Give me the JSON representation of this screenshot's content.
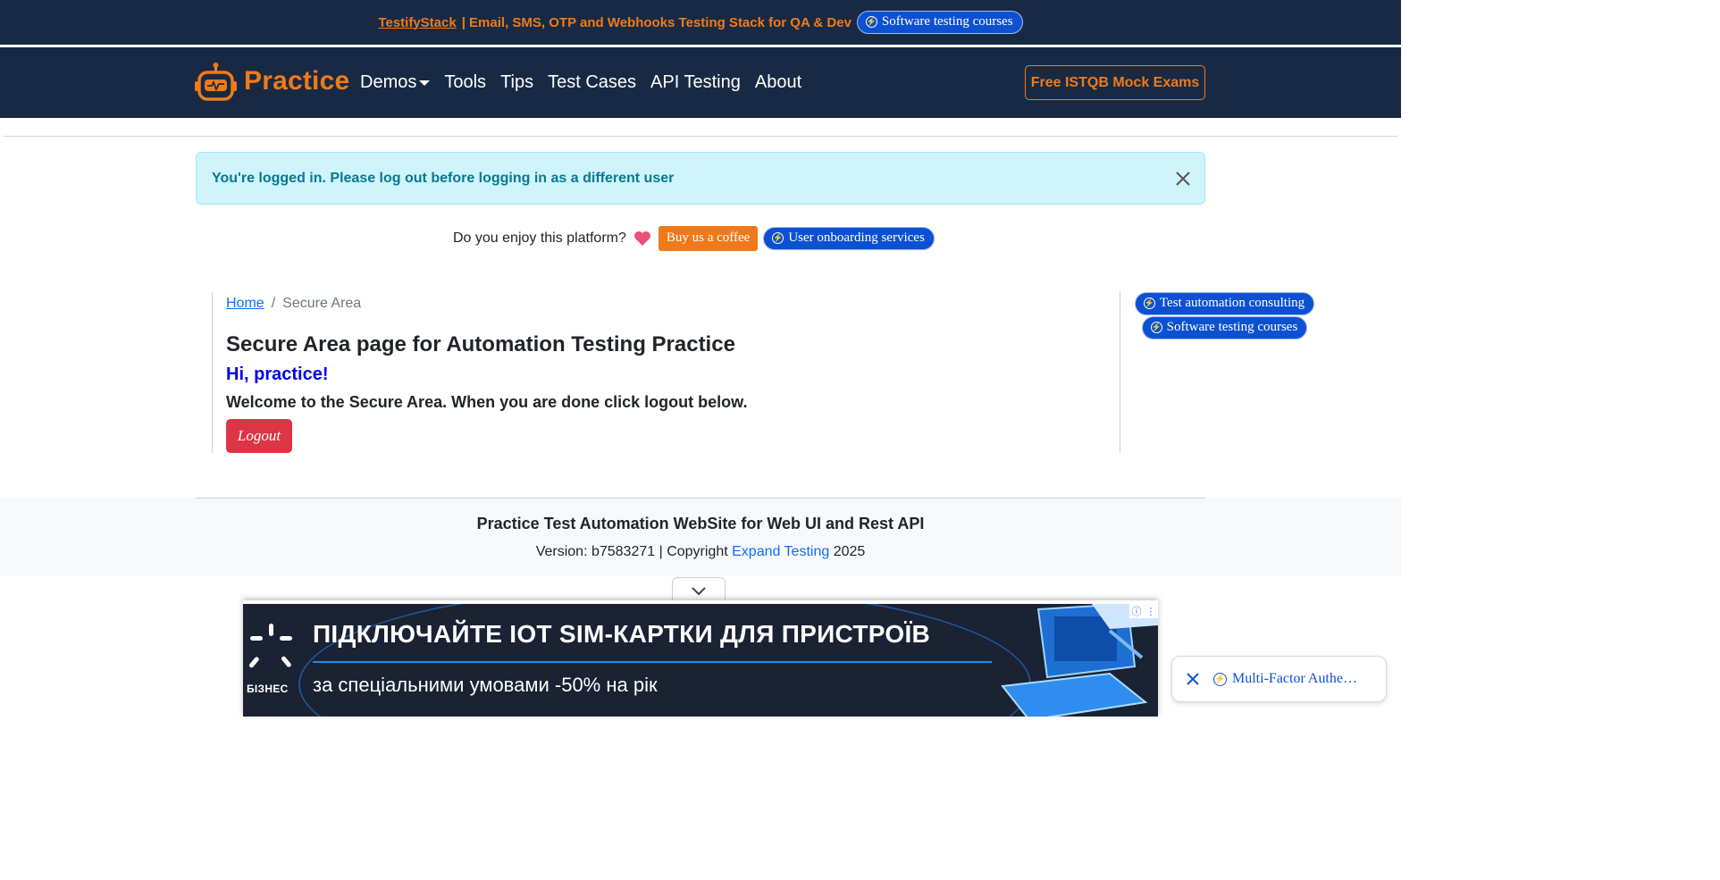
{
  "promo": {
    "brand": "TestifyStack",
    "text": " | Email, SMS, OTP and Webhooks Testing Stack for QA & Dev",
    "pill_label": "Software testing courses"
  },
  "navbar": {
    "logo_text": "Practice",
    "links": [
      "Demos",
      "Tools",
      "Tips",
      "Test Cases",
      "API Testing",
      "About"
    ],
    "cta": "Free ISTQB Mock Exams"
  },
  "alert": {
    "message": "You're logged in. Please log out before logging in as a different user"
  },
  "enjoy": {
    "question": "Do you enjoy this platform?",
    "coffee_label": "Buy us a coffee",
    "onboarding_label": "User onboarding services"
  },
  "breadcrumb": {
    "home": "Home",
    "separator": "/",
    "current": "Secure Area"
  },
  "main": {
    "title": "Secure Area page for Automation Testing Practice",
    "greeting": "Hi, practice!",
    "welcome": "Welcome to the Secure Area. When you are done click logout below.",
    "logout_label": "Logout"
  },
  "side": {
    "consulting": "Test automation consulting",
    "courses": "Software testing courses"
  },
  "footer": {
    "title": "Practice Test Automation WebSite for Web UI and Rest API",
    "version_prefix": "Version: b7583271 | Copyright ",
    "company": "Expand Testing",
    "year": " 2025"
  },
  "ad": {
    "logo_text": "БІЗНЕС",
    "headline": "ПІДКЛЮЧАЙТЕ IOT SIM-КАРТКИ ДЛЯ ПРИСТРОЇВ",
    "subline": "за спеціальними умовами -50% на рік"
  },
  "floating": {
    "label": "Multi-Factor Authe…"
  },
  "colors": {
    "navy": "#182a43",
    "orange": "#f07a1a",
    "blue_pill": "#0d51d2",
    "alert_bg": "#cff4fc",
    "alert_text": "#087990",
    "danger": "#dc3545"
  }
}
